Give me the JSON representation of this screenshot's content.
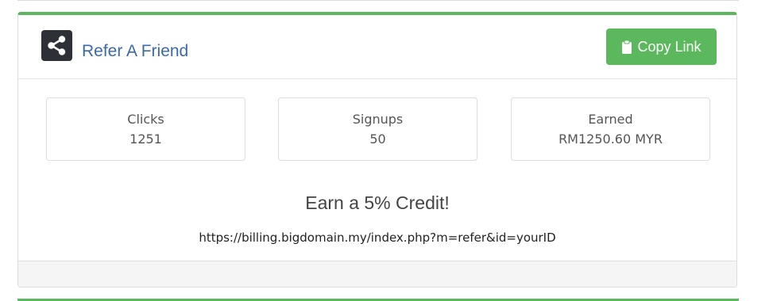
{
  "header": {
    "title": "Refer A Friend",
    "icon": "share-icon",
    "copy_button_label": "Copy Link",
    "copy_button_icon": "clipboard-icon"
  },
  "stats": [
    {
      "label": "Clicks",
      "value": "1251"
    },
    {
      "label": "Signups",
      "value": "50"
    },
    {
      "label": "Earned",
      "value": "RM1250.60 MYR"
    }
  ],
  "promo": {
    "heading": "Earn a 5% Credit!",
    "url": "https://billing.bigdomain.my/index.php?m=refer&id=yourID"
  },
  "colors": {
    "accent": "#5cb85c",
    "title": "#3a6aa8",
    "icon_bg": "#2d3036"
  }
}
